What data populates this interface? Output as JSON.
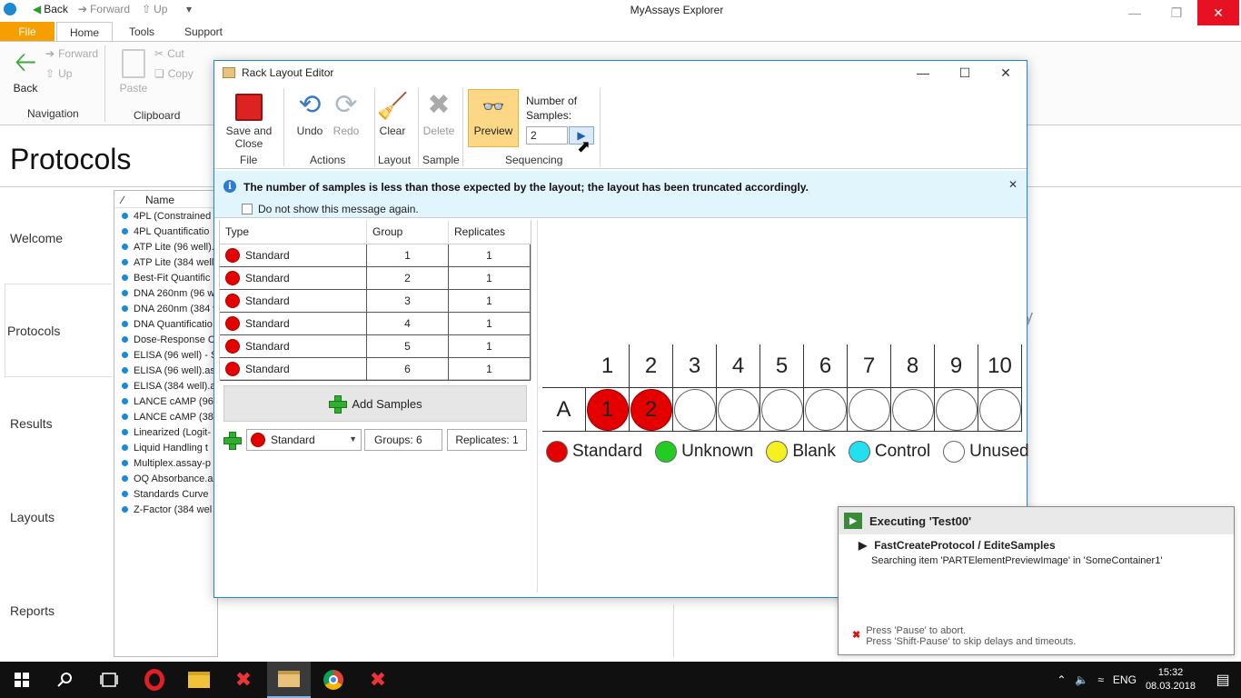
{
  "app": {
    "title": "MyAssays Explorer",
    "quick_access": {
      "back": "Back",
      "forward": "Forward",
      "up": "Up"
    }
  },
  "ribbon_tabs": [
    "File",
    "Home",
    "Tools",
    "Support"
  ],
  "ribbon": {
    "back": "Back",
    "forward": "Forward",
    "up": "Up",
    "paste": "Paste",
    "cut": "Cut",
    "copy": "Copy",
    "group_navigation": "Navigation",
    "group_clipboard": "Clipboard"
  },
  "page_title": "Protocols",
  "nav": [
    "Welcome",
    "Protocols",
    "Results",
    "Layouts",
    "Reports"
  ],
  "protocol_list": {
    "header_name": "Name",
    "items": [
      "4PL (Constrained",
      "4PL Quantificatio",
      "ATP Lite (96 well).",
      "ATP Lite (384 well)",
      "Best-Fit Quantific",
      "DNA 260nm (96 w",
      "DNA 260nm (384 w",
      "DNA Quantificatio",
      "Dose-Response C",
      "ELISA (96 well) - S",
      "ELISA (96 well).ass",
      "ELISA (384 well).a",
      "LANCE cAMP (96 w",
      "LANCE cAMP (384",
      "Linearized (Logit-",
      "Liquid Handling t",
      "Multiplex.assay-p",
      "OQ Absorbance.a",
      "Standards Curve",
      "Z-Factor (384 wel"
    ]
  },
  "background_fragment": "y",
  "dialog": {
    "title": "Rack Layout Editor",
    "buttons": {
      "save_close": "Save and Close",
      "undo": "Undo",
      "redo": "Redo",
      "clear": "Clear",
      "delete": "Delete",
      "preview": "Preview"
    },
    "groups": {
      "file": "File",
      "actions": "Actions",
      "layout": "Layout",
      "sample": "Sample",
      "sequencing": "Sequencing"
    },
    "num_samples_label": "Number of Samples:",
    "num_samples_value": "2",
    "info_message": "The number of samples is less than those expected by the layout; the layout has been truncated accordingly.",
    "dont_show": "Do not show this message again.",
    "table": {
      "headers": [
        "Type",
        "Group",
        "Replicates"
      ],
      "rows": [
        {
          "type": "Standard",
          "group": "1",
          "replicates": "1"
        },
        {
          "type": "Standard",
          "group": "2",
          "replicates": "1"
        },
        {
          "type": "Standard",
          "group": "3",
          "replicates": "1"
        },
        {
          "type": "Standard",
          "group": "4",
          "replicates": "1"
        },
        {
          "type": "Standard",
          "group": "5",
          "replicates": "1"
        },
        {
          "type": "Standard",
          "group": "6",
          "replicates": "1"
        }
      ]
    },
    "add_samples": "Add Samples",
    "new_type": "Standard",
    "groups_field": "Groups: 6",
    "replicates_field": "Replicates: 1",
    "plate": {
      "columns": [
        "1",
        "2",
        "3",
        "4",
        "5",
        "6",
        "7",
        "8",
        "9",
        "10"
      ],
      "row": "A",
      "wells": [
        "1",
        "2",
        "",
        "",
        "",
        "",
        "",
        "",
        "",
        ""
      ]
    },
    "legend": [
      {
        "label": "Standard",
        "color": "#e50000"
      },
      {
        "label": "Unknown",
        "color": "#22cc22"
      },
      {
        "label": "Blank",
        "color": "#f5f020"
      },
      {
        "label": "Control",
        "color": "#22e0f0"
      },
      {
        "label": "Unused",
        "color": "#ffffff"
      }
    ]
  },
  "exec": {
    "title": "Executing 'Test00'",
    "step": "FastCreateProtocol / EditeSamples",
    "detail": "Searching item 'PARTElementPreviewImage' in 'SomeContainer1'",
    "hint1": "Press 'Pause' to abort.",
    "hint2": "Press 'Shift-Pause' to skip delays and timeouts."
  },
  "taskbar": {
    "lang": "ENG",
    "time": "15:32",
    "date": "08.03.2018"
  }
}
